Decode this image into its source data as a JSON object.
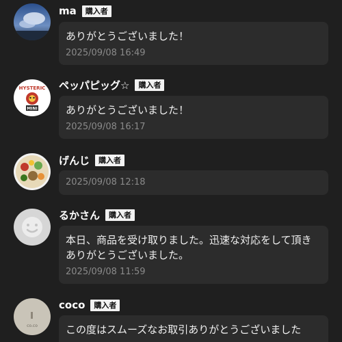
{
  "comments": [
    {
      "username": "ma",
      "badge": "購入者",
      "avatar_icon": "sky-landscape-avatar",
      "text": "ありがとうございました！",
      "time": "2025/09/08 16:49"
    },
    {
      "username": "ペッパピッグ☆",
      "badge": "購入者",
      "avatar_icon": "hysteric-mini-logo-avatar",
      "avatar_logo_top": "HYSTERIC",
      "avatar_logo_bottom": "MINI",
      "text": "ありがとうございました！",
      "time": "2025/09/08 16:17"
    },
    {
      "username": "げんじ",
      "badge": "購入者",
      "avatar_icon": "food-plate-avatar",
      "text": "",
      "time": "2025/09/08 12:18"
    },
    {
      "username": "るかさん",
      "badge": "購入者",
      "avatar_icon": "default-user-avatar",
      "text": "本日、商品を受け取りました。迅速な対応をして頂きありがとうございました。",
      "time": "2025/09/08 11:59"
    },
    {
      "username": "coco",
      "badge": "購入者",
      "avatar_icon": "coco-logo-avatar",
      "avatar_label": "co.co",
      "text": "この度はスムーズなお取引ありがとうございました",
      "time": ""
    }
  ],
  "colors": {
    "background": "#1f1f1f",
    "bubble": "#2c2c2c",
    "badge_bg": "#f2f2f2",
    "timestamp": "#8a8a8a"
  }
}
